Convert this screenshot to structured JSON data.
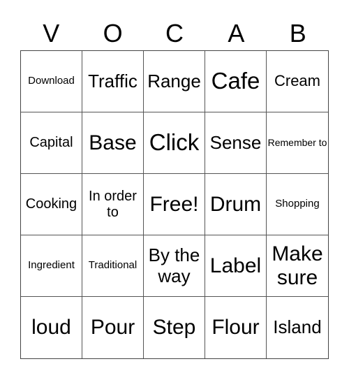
{
  "header": {
    "letters": [
      "V",
      "O",
      "C",
      "A",
      "B"
    ]
  },
  "grid": {
    "rows": [
      [
        "Download",
        "Traffic",
        "Range",
        "Cafe",
        "Cream"
      ],
      [
        "Capital",
        "Base",
        "Click",
        "Sense",
        "Remember to"
      ],
      [
        "Cooking",
        "In order to",
        "Free!",
        "Drum",
        "Shopping"
      ],
      [
        "Ingredient",
        "Traditional",
        "By the way",
        "Label",
        "Make sure"
      ],
      [
        "loud",
        "Pour",
        "Step",
        "Flour",
        "Island"
      ]
    ]
  }
}
